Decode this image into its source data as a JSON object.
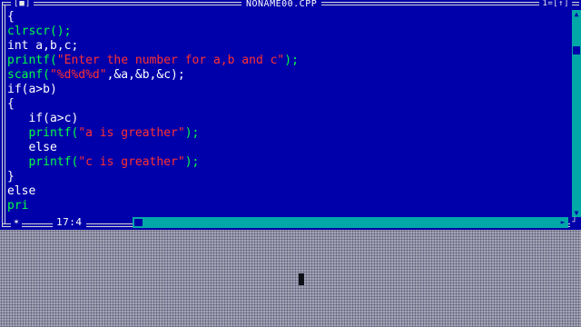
{
  "window": {
    "title": "NONAME00.CPP",
    "close_box": "[■]",
    "controls": "1=[↑]"
  },
  "status": {
    "star": "✶",
    "cursor_position": "17:4"
  },
  "scrollbars": {
    "up_arrow": "▲",
    "down_arrow": "▼",
    "left_arrow": "◄",
    "right_arrow": "►",
    "resize_corner": "┘"
  },
  "colors": {
    "editor_background": "#0000aa",
    "text_default": "#ffffff",
    "text_string": "#ff3030",
    "text_function": "#00ff44",
    "frame": "#d8d8d8",
    "scrollbar": "#00a8a8",
    "desktop": "#a8a8b8"
  },
  "code": [
    [
      {
        "t": "{",
        "c": "white"
      }
    ],
    [
      {
        "t": "clrscr();",
        "c": "green"
      }
    ],
    [
      {
        "t": "int a,b,c;",
        "c": "white"
      }
    ],
    [
      {
        "t": "printf(",
        "c": "green"
      },
      {
        "t": "\"Enter the number for a,b and c\"",
        "c": "red"
      },
      {
        "t": ");",
        "c": "green"
      }
    ],
    [
      {
        "t": "scanf(",
        "c": "green"
      },
      {
        "t": "\"%d%d%d\"",
        "c": "red"
      },
      {
        "t": ",&a,&b,&c);",
        "c": "white"
      }
    ],
    [
      {
        "t": "if(a>b)",
        "c": "white"
      }
    ],
    [
      {
        "t": "{",
        "c": "white"
      }
    ],
    [
      {
        "t": "   if(a>c)",
        "c": "white"
      }
    ],
    [
      {
        "t": "   printf(",
        "c": "green"
      },
      {
        "t": "\"a is greather\"",
        "c": "red"
      },
      {
        "t": ");",
        "c": "green"
      }
    ],
    [
      {
        "t": "   else",
        "c": "white"
      }
    ],
    [
      {
        "t": "   printf(",
        "c": "green"
      },
      {
        "t": "\"c is greather\"",
        "c": "red"
      },
      {
        "t": ");",
        "c": "green"
      }
    ],
    [
      {
        "t": "}",
        "c": "white"
      }
    ],
    [
      {
        "t": "else",
        "c": "white"
      }
    ],
    [
      {
        "t": "pri",
        "c": "green"
      }
    ]
  ]
}
